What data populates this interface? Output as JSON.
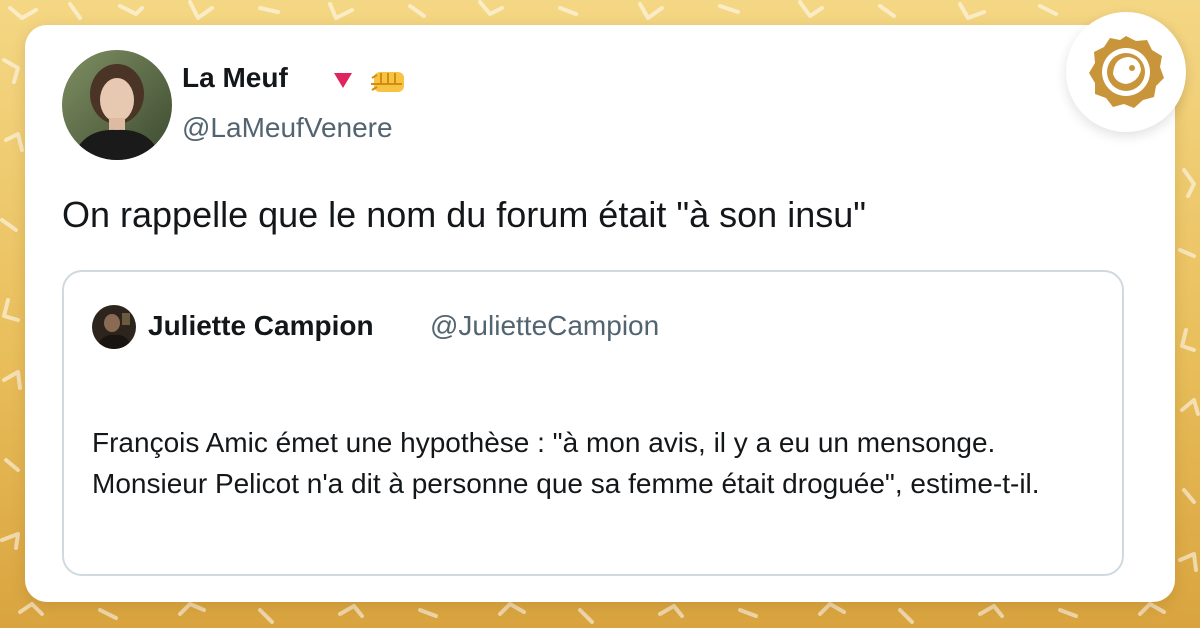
{
  "colors": {
    "background_top": "#f4d784",
    "background_bottom": "#d9a43f",
    "card": "#ffffff",
    "text_primary": "#14171a",
    "text_secondary": "#536471",
    "quote_border": "#cfd9de",
    "badge_red": "#e0245e",
    "logo_gold": "#c9953a"
  },
  "tweet": {
    "author_name": "La Meuf",
    "author_handle": "@LaMeufVenere",
    "text": "On rappelle que le nom du forum était \"à son insu\"",
    "name_icons": [
      "red-triangle-icon",
      "raised-fist-icon"
    ]
  },
  "quoted_tweet": {
    "author_name": "Juliette Campion",
    "author_handle": "@JulietteCampion",
    "text": "François Amic émet une hypothèse : \"à mon avis, il y a eu un mensonge. Monsieur Pelicot n'a dit à personne que sa femme était droguée\", estime-t-il."
  },
  "logo": {
    "icon": "bird-in-circle-logo-icon"
  }
}
